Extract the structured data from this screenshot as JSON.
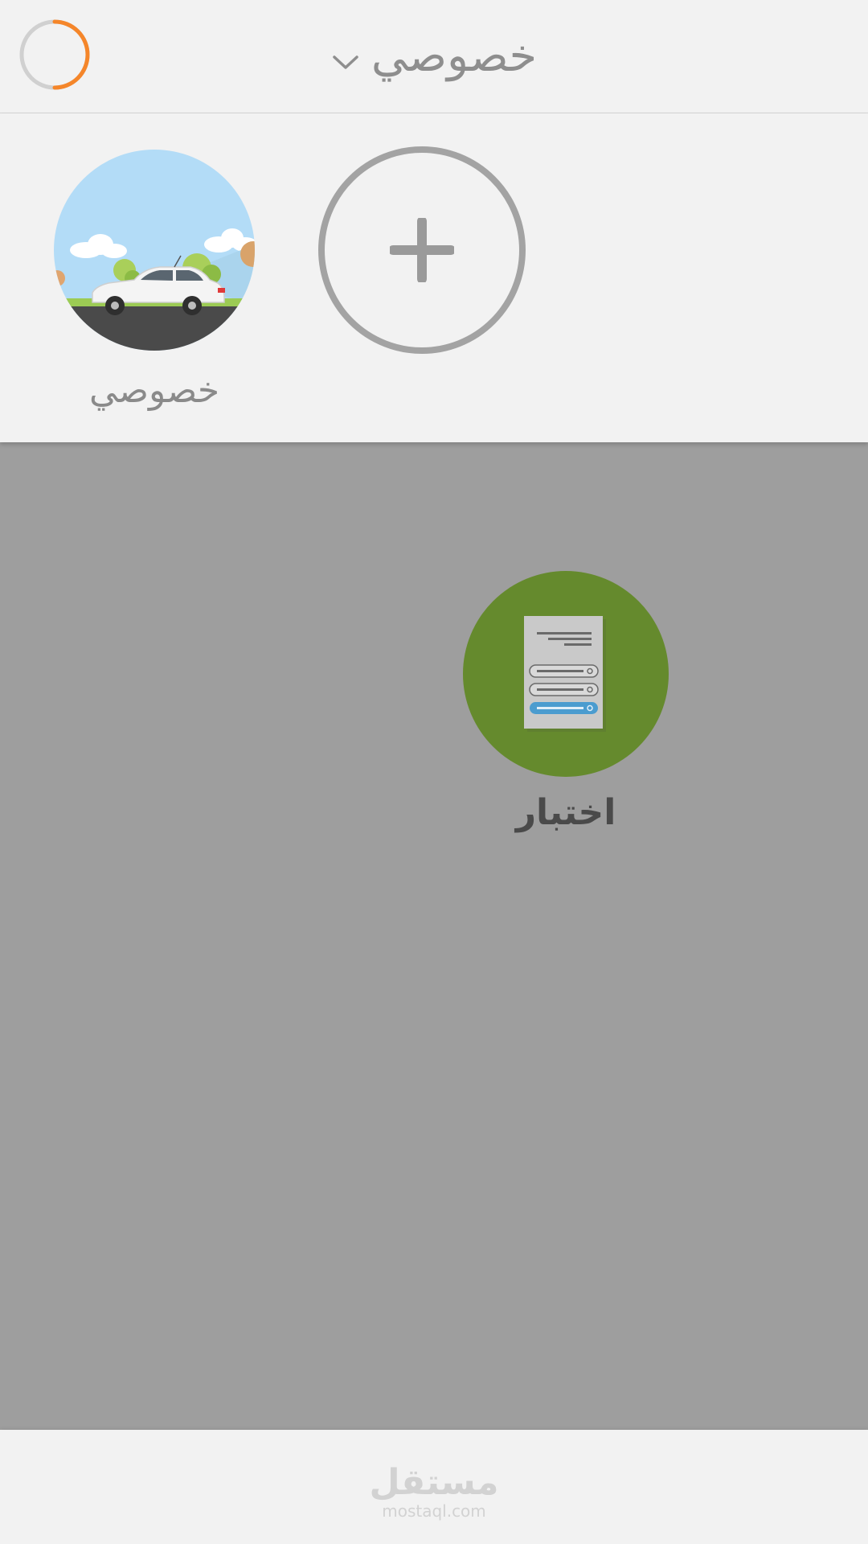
{
  "header": {
    "title": "خصوصي",
    "accent_color": "#f5862a",
    "progress": 0.33
  },
  "profiles": [
    {
      "label": "خصوصي",
      "image": "car-scene"
    }
  ],
  "add_profile": {
    "icon": "plus-icon"
  },
  "tiles": [
    {
      "label": "اختبار",
      "icon": "form-document-icon",
      "color": "#658a2d"
    }
  ],
  "footer": {
    "watermark_ar": "مستقل",
    "watermark_en": "mostaql.com"
  }
}
